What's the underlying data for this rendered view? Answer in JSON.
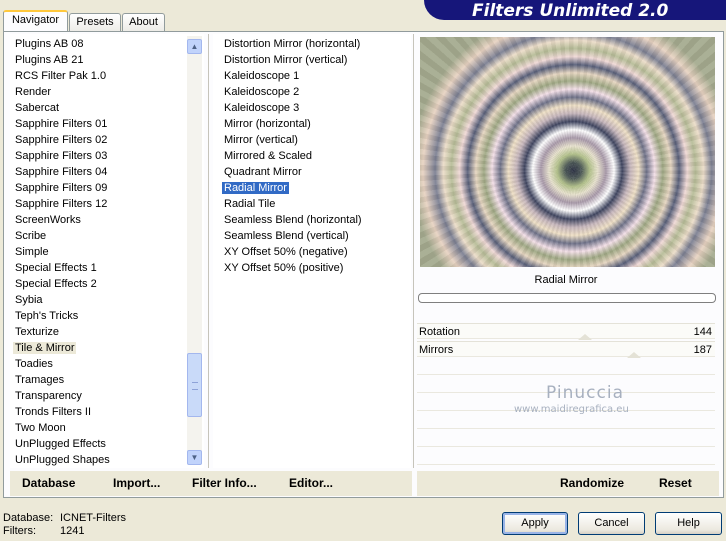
{
  "tabs": [
    {
      "label": "Navigator"
    },
    {
      "label": "Presets"
    },
    {
      "label": "About"
    }
  ],
  "brand": "Filters Unlimited 2.0",
  "categories": [
    "Plugins AB 08",
    "Plugins AB 21",
    "RCS Filter Pak 1.0",
    "Render",
    "Sabercat",
    "Sapphire Filters 01",
    "Sapphire Filters 02",
    "Sapphire Filters 03",
    "Sapphire Filters 04",
    "Sapphire Filters 09",
    "Sapphire Filters 12",
    "ScreenWorks",
    "Scribe",
    "Simple",
    "Special Effects 1",
    "Special Effects 2",
    "Sybia",
    "Teph's Tricks",
    "Texturize",
    "Tile & Mirror",
    "Toadies",
    "Tramages",
    "Transparency",
    "Tronds Filters II",
    "Two Moon",
    "UnPlugged Effects",
    "UnPlugged Shapes"
  ],
  "selected_category": "Tile & Mirror",
  "filters": [
    "Distortion Mirror (horizontal)",
    "Distortion Mirror (vertical)",
    "Kaleidoscope 1",
    "Kaleidoscope 2",
    "Kaleidoscope 3",
    "Mirror (horizontal)",
    "Mirror (vertical)",
    "Mirrored & Scaled",
    "Quadrant Mirror",
    "Radial Mirror",
    "Radial Tile",
    "Seamless Blend (horizontal)",
    "Seamless Blend (vertical)",
    "XY Offset 50% (negative)",
    "XY Offset 50% (positive)"
  ],
  "selected_filter": "Radial Mirror",
  "preview": {
    "filter_name": "Radial Mirror"
  },
  "params": [
    {
      "label": "Rotation",
      "value": "144"
    },
    {
      "label": "Mirrors",
      "value": "187"
    }
  ],
  "watermark": {
    "name": "Pinuccia",
    "url": "www.maidiregrafica.eu"
  },
  "toolbar": {
    "database": "Database",
    "import": "Import...",
    "filter_info": "Filter Info...",
    "editor": "Editor...",
    "randomize": "Randomize",
    "reset": "Reset"
  },
  "status": {
    "database_label": "Database:",
    "database_value": "ICNET-Filters",
    "filters_label": "Filters:",
    "filters_value": "1241"
  },
  "buttons": {
    "apply": "Apply",
    "cancel": "Cancel",
    "help": "Help"
  }
}
